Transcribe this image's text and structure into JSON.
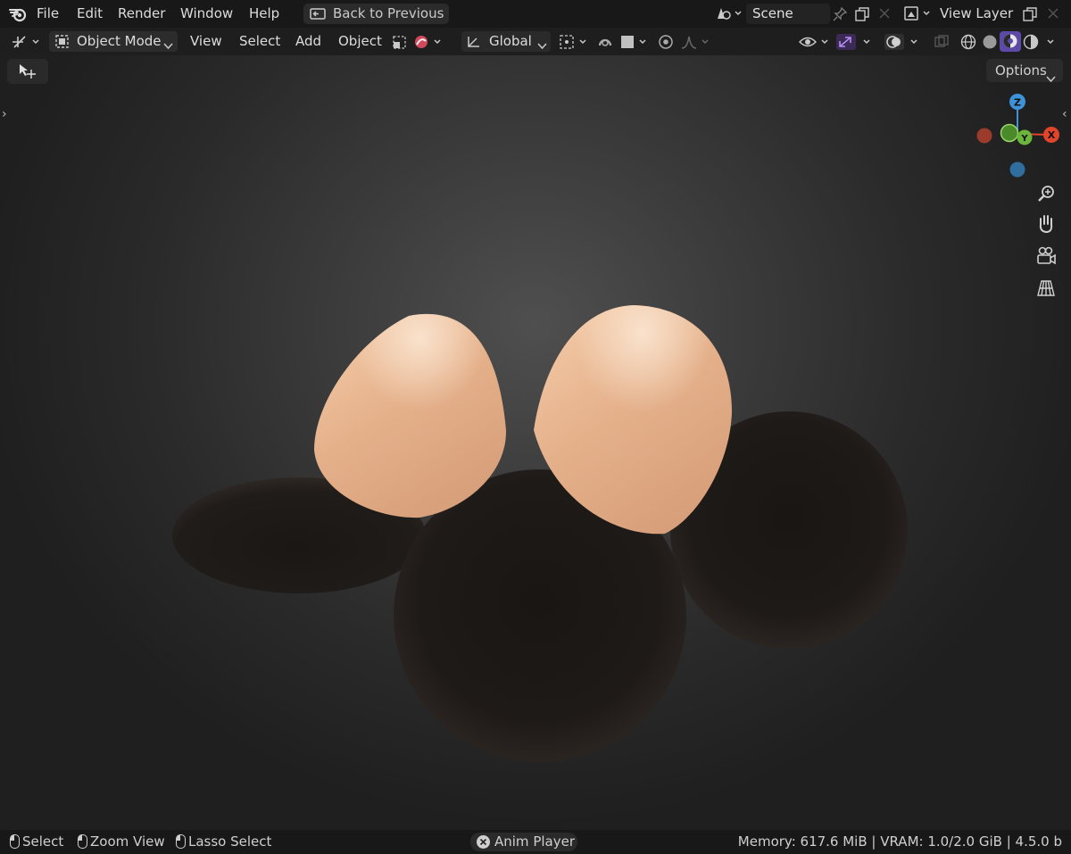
{
  "menu": {
    "items": [
      "File",
      "Edit",
      "Render",
      "Window",
      "Help"
    ],
    "back_label": "Back to Previous",
    "scene_label": "Scene",
    "view_layer_label": "View Layer"
  },
  "header": {
    "mode_label": "Object Mode",
    "menus": [
      "View",
      "Select",
      "Add",
      "Object"
    ],
    "orientation_label": "Global"
  },
  "viewport": {
    "options_label": "Options",
    "gizmo": {
      "z": "Z",
      "y": "Y",
      "x": "X"
    }
  },
  "status": {
    "hints": [
      "Select",
      "Zoom View",
      "Lasso Select"
    ],
    "anim_player": "Anim Player",
    "info": "Memory: 617.6 MiB | VRAM: 1.0/2.0 GiB | 4.5.0 b"
  },
  "colors": {
    "axis_x": "#e0442c",
    "axis_y": "#6bb53a",
    "axis_z": "#3d92d8",
    "active_shading": "#5c4aa6",
    "ear_color": "#e8b48e",
    "sphere_color": "#1b1816"
  }
}
